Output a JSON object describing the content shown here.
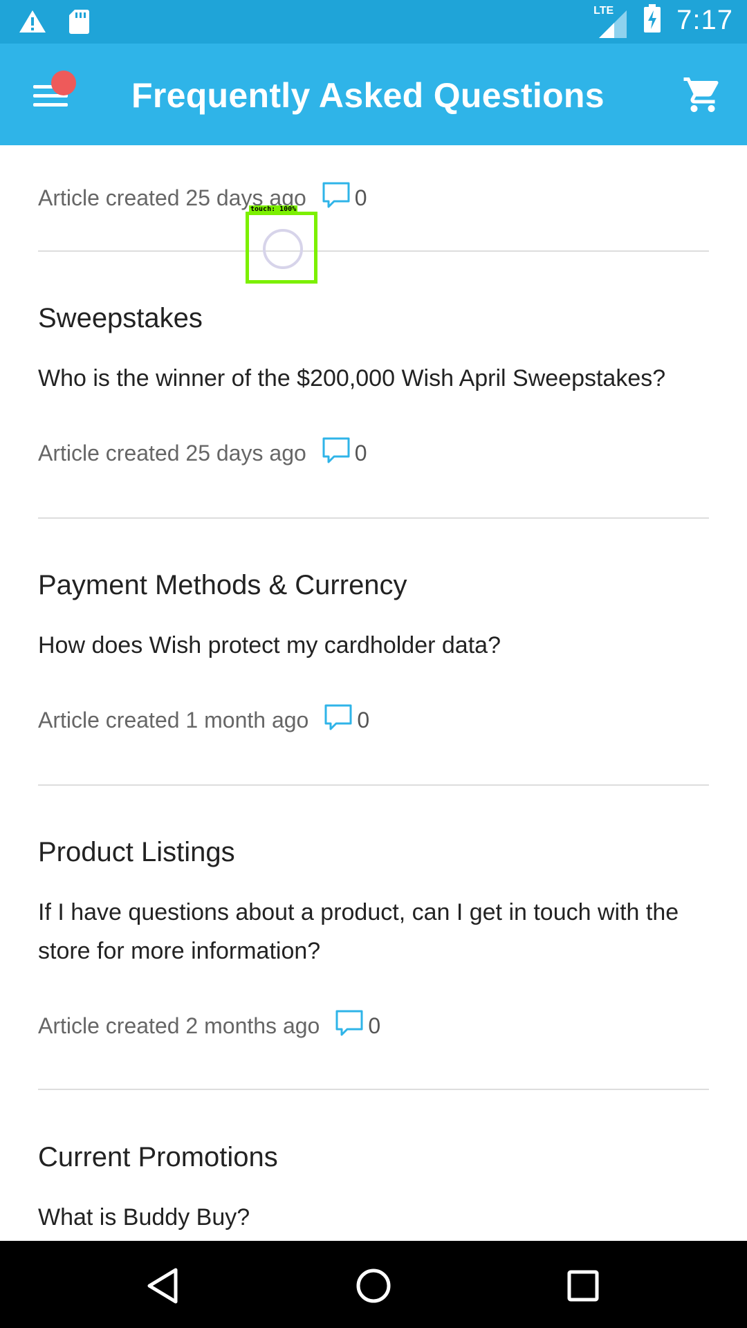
{
  "status_bar": {
    "time": "7:17",
    "network": "LTE",
    "icons": [
      "warning-icon",
      "sd-card-icon",
      "lte-signal-icon",
      "battery-charging-icon"
    ]
  },
  "app_bar": {
    "title": "Frequently Asked Questions",
    "menu_icon": "menu-icon",
    "cart_icon": "cart-icon",
    "has_notification_dot": true
  },
  "articles": [
    {
      "category": "",
      "question": "",
      "meta": "Article created 25 days ago",
      "comments": "0"
    },
    {
      "category": "Sweepstakes",
      "question": "Who is the winner of the $200,000 Wish April Sweepstakes?",
      "meta": "Article created 25 days ago",
      "comments": "0"
    },
    {
      "category": "Payment Methods & Currency",
      "question": "How does Wish protect my cardholder data?",
      "meta": "Article created 1 month ago",
      "comments": "0"
    },
    {
      "category": "Product Listings",
      "question": "If I have questions about a product, can I get in touch with the store for more information?",
      "meta": "Article created 2 months ago",
      "comments": "0"
    },
    {
      "category": "Current Promotions",
      "question": "What is Buddy Buy?",
      "meta": "",
      "comments": ""
    }
  ],
  "touch_overlay": {
    "label": "touch: 100%"
  },
  "nav_bar": {
    "icons": [
      "back-icon",
      "home-icon",
      "recents-icon"
    ]
  },
  "colors": {
    "status_bar": "#1fa4d8",
    "app_bar": "#2fb4e8",
    "accent_icon": "#2fb4e8",
    "notification_dot": "#ee5a5a",
    "touch_box": "#7cf000"
  }
}
